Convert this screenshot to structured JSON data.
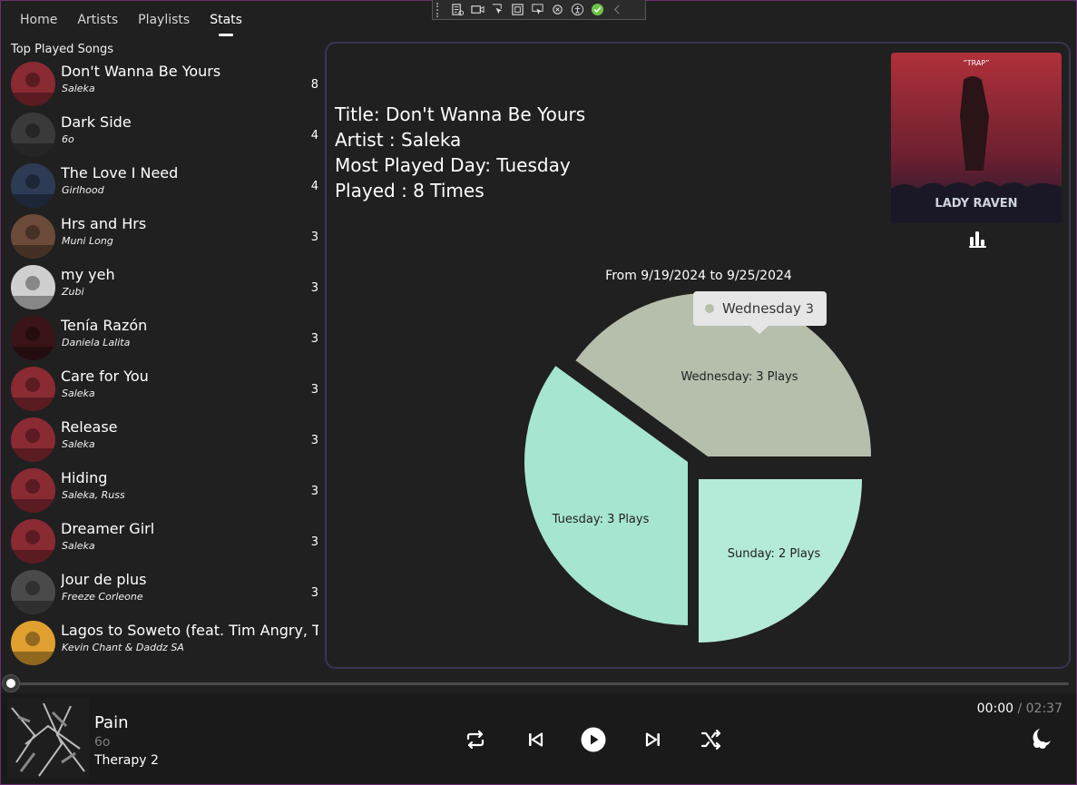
{
  "nav": {
    "tabs": [
      {
        "label": "Home",
        "active": false
      },
      {
        "label": "Artists",
        "active": false
      },
      {
        "label": "Playlists",
        "active": false
      },
      {
        "label": "Stats",
        "active": true
      }
    ]
  },
  "devtools": {
    "icons": [
      "live-tree-icon",
      "record-icon",
      "select-element-icon",
      "display-layout-icon",
      "track-focus-icon",
      "hot-reload-icon",
      "accessibility-icon",
      "check-icon",
      "collapse-icon"
    ]
  },
  "top_songs": {
    "title": "Top Played Songs",
    "items": [
      {
        "title": "Don't Wanna Be Yours",
        "artist": "Saleka",
        "count": "8",
        "thumb_color": "#8a2a33"
      },
      {
        "title": "Dark Side",
        "artist": "6o",
        "count": "4",
        "thumb_color": "#3a3a3a"
      },
      {
        "title": "The Love I Need",
        "artist": "Girlhood",
        "count": "4",
        "thumb_color": "#2d3b55"
      },
      {
        "title": "Hrs and Hrs",
        "artist": "Muni Long",
        "count": "3",
        "thumb_color": "#6b4a3a"
      },
      {
        "title": "my yeh",
        "artist": "Zubi",
        "count": "3",
        "thumb_color": "#cfcfcf"
      },
      {
        "title": "Tenía Razón",
        "artist": "Daniela Lalita",
        "count": "3",
        "thumb_color": "#3a1418"
      },
      {
        "title": "Care for You",
        "artist": "Saleka",
        "count": "3",
        "thumb_color": "#8a2a33"
      },
      {
        "title": "Release",
        "artist": "Saleka",
        "count": "3",
        "thumb_color": "#8a2a33"
      },
      {
        "title": "Hiding",
        "artist": "Saleka, Russ",
        "count": "3",
        "thumb_color": "#8a2a33"
      },
      {
        "title": "Dreamer Girl",
        "artist": "Saleka",
        "count": "3",
        "thumb_color": "#8a2a33"
      },
      {
        "title": "Jour de plus",
        "artist": "Freeze Corleone",
        "count": "3",
        "thumb_color": "#4a4a4a"
      },
      {
        "title": "Lagos to Soweto (feat. Tim Angry, Tem",
        "artist": "Kevin Chant & Daddz SA",
        "count": "",
        "thumb_color": "#e0a030"
      }
    ]
  },
  "stats": {
    "title_line": "Title: Don't Wanna Be Yours",
    "artist_line": "Artist : Saleka",
    "day_line": "Most Played Day: Tuesday",
    "played_line": "Played : 8 Times",
    "cover_top_text": "“TRAP”",
    "cover_title": "LADY RAVEN"
  },
  "chart_data": {
    "type": "pie",
    "title": "From 9/19/2024 to 9/25/2024",
    "slices": [
      {
        "label": "Wednesday: 3 Plays",
        "name": "Wednesday",
        "value": 3,
        "color": "#b5bfac",
        "exploded": true
      },
      {
        "label": "Sunday: 2 Plays",
        "name": "Sunday",
        "value": 2,
        "color": "#b4ead8",
        "exploded": false
      },
      {
        "label": "Tuesday: 3 Plays",
        "name": "Tuesday",
        "value": 3,
        "color": "#a6e5d0",
        "exploded": true
      }
    ],
    "tooltip": {
      "name": "Wednesday",
      "value": "3",
      "dot_color": "#b5bfac"
    }
  },
  "player": {
    "title": "Pain",
    "artist": "6o",
    "album": "Therapy 2",
    "current_time": "00:00",
    "separator": " / ",
    "total_time": "02:37",
    "progress": 0
  },
  "colors": {
    "accent_border": "#6b2f6f",
    "panel_border": "#3b3350"
  }
}
